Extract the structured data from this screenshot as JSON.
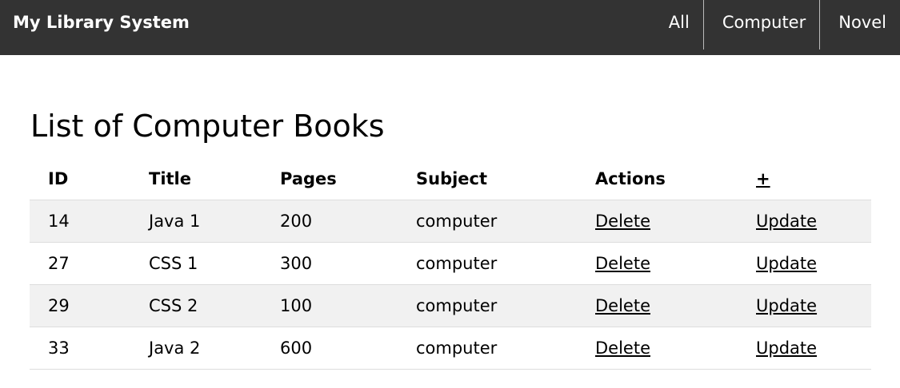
{
  "header": {
    "brand": "My Library System",
    "nav": [
      {
        "label": "All"
      },
      {
        "label": "Computer"
      },
      {
        "label": "Novel"
      }
    ]
  },
  "main": {
    "title": "List of Computer Books",
    "table": {
      "columns": [
        "ID",
        "Title",
        "Pages",
        "Subject",
        "Actions",
        "+"
      ],
      "rows": [
        {
          "id": "14",
          "title": "Java 1",
          "pages": "200",
          "subject": "computer",
          "delete": "Delete",
          "update": "Update"
        },
        {
          "id": "27",
          "title": "CSS 1",
          "pages": "300",
          "subject": "computer",
          "delete": "Delete",
          "update": "Update"
        },
        {
          "id": "29",
          "title": "CSS 2",
          "pages": "100",
          "subject": "computer",
          "delete": "Delete",
          "update": "Update"
        },
        {
          "id": "33",
          "title": "Java 2",
          "pages": "600",
          "subject": "computer",
          "delete": "Delete",
          "update": "Update"
        }
      ]
    }
  },
  "colors": {
    "topbar": "#333333",
    "row_stripe": "#f1f1f1",
    "row_border": "#dddddd"
  }
}
